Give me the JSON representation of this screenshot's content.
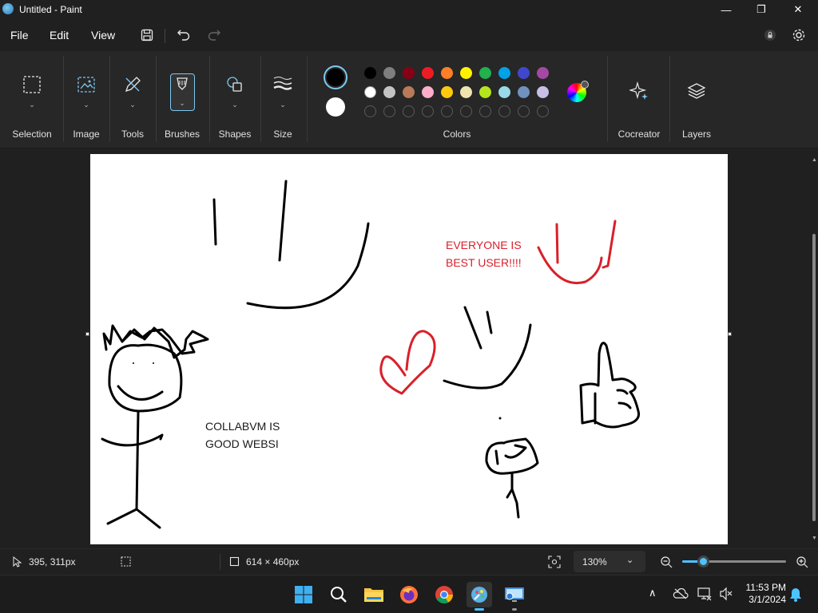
{
  "window": {
    "title": "Untitled - Paint",
    "minimize_glyph": "—",
    "maximize_glyph": "❐",
    "close_glyph": "✕"
  },
  "menu": {
    "file": "File",
    "edit": "Edit",
    "view": "View"
  },
  "ribbon": {
    "selection": "Selection",
    "image": "Image",
    "tools": "Tools",
    "brushes": "Brushes",
    "shapes": "Shapes",
    "size": "Size",
    "colors": "Colors",
    "cocreator": "Cocreator",
    "layers": "Layers"
  },
  "colors": {
    "primary": "#000000",
    "secondary": "#ffffff",
    "row1": [
      "#000000",
      "#7f7f7f",
      "#880015",
      "#ed1c24",
      "#ff7f27",
      "#fff200",
      "#22b14c",
      "#00a2e8",
      "#3f48cc",
      "#a349a4"
    ],
    "row2": [
      "#ffffff",
      "#c3c3c3",
      "#b97a57",
      "#ffaec9",
      "#ffc90e",
      "#efe4b0",
      "#b5e61d",
      "#99d9ea",
      "#7092be",
      "#c8bfe7"
    ]
  },
  "canvas_text": {
    "everyone": "EVERYONE IS\nBEST USER!!!!",
    "collabvm": "COLLABVM IS\nGOOD WEBSI"
  },
  "status": {
    "cursor_pos": "395, 311px",
    "canvas_size": "614 × 460px",
    "zoom": "130%",
    "zoom_slider_fraction": 0.2
  },
  "taskbar": {
    "time": "11:53 PM",
    "date": "3/1/2024"
  }
}
